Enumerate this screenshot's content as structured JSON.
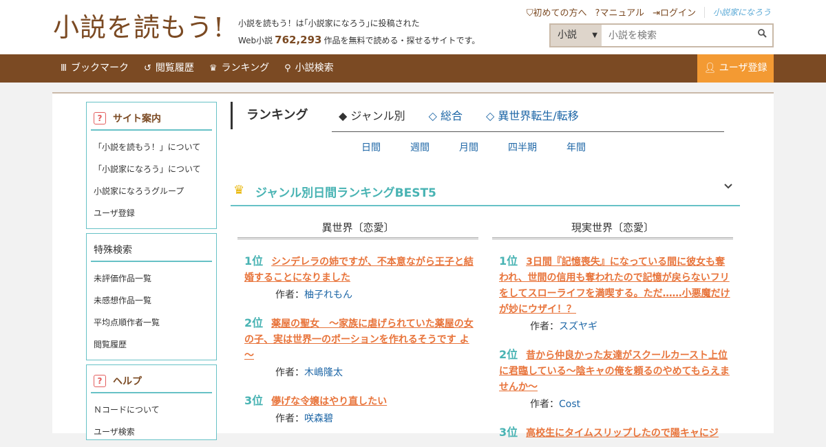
{
  "header": {
    "logo": "小説を読もう!",
    "intro_line1": "小説を読もう！は｢小説家になろう｣に投稿された",
    "intro_prefix": "Web小説",
    "intro_count": "762,293",
    "intro_suffix": "作品を無料で読める・探せるサイトです。",
    "links": [
      "初めての方へ",
      "マニュアル",
      "ログイン"
    ],
    "partner_logo": "小説家になろう",
    "search": {
      "select_value": "小説",
      "placeholder": "小説を検索"
    }
  },
  "nav": {
    "items": [
      {
        "label": "ブックマーク",
        "icon": "bookmark-icon"
      },
      {
        "label": "閲覧履歴",
        "icon": "history-icon"
      },
      {
        "label": "ランキング",
        "icon": "crown-icon"
      },
      {
        "label": "小説検索",
        "icon": "search-icon"
      }
    ],
    "register": "ユーザ登録"
  },
  "sidebar": {
    "site_guide": {
      "title": "サイト案内",
      "items": [
        "「小説を読もう！」について",
        "「小説家になろう」について",
        "小説家になろうグループ",
        "ユーザ登録"
      ]
    },
    "special_search": {
      "title": "特殊検索",
      "items": [
        "未評価作品一覧",
        "未感想作品一覧",
        "平均点順作者一覧",
        "閲覧履歴"
      ]
    },
    "help": {
      "title": "ヘルプ",
      "items": [
        "Ｎコードについて",
        "ユーザ検索"
      ]
    }
  },
  "main": {
    "heading": "ランキング",
    "tabs": [
      "◆ ジャンル別",
      "◇ 総合",
      "◇ 異世界転生/転移"
    ],
    "periods": [
      "日間",
      "週間",
      "月間",
      "四半期",
      "年間"
    ],
    "best_title": "ジャンル別日間ランキングBEST5",
    "author_label": "作者：",
    "columns": [
      {
        "genre": "異世界〔恋愛〕",
        "entries": [
          {
            "rank": "1位",
            "title": "シンデレラの姉ですが、不本意ながら王子と結婚することになりました",
            "author": "柚子れもん"
          },
          {
            "rank": "2位",
            "title": "薬屋の聖女　～家族に虐げられていた薬屋の女の子、実は世界一のポーションを作れるそうです よ～",
            "author": "木嶋隆太"
          },
          {
            "rank": "3位",
            "title": "儚げな令嬢はやり直したい",
            "author": "咲森碧"
          }
        ]
      },
      {
        "genre": "現実世界〔恋愛〕",
        "entries": [
          {
            "rank": "1位",
            "title": "3日間『記憶喪失』になっている間に彼女も奪われ、世間の信用も奪われたので記憶が戻らないフリをしてスローライフを満喫する。ただ……小悪魔だけが妙にウザイ！？",
            "author": "スズヤギ"
          },
          {
            "rank": "2位",
            "title": "昔から仲良かった友達がスクールカースト上位に君臨している～陰キャの俺を頼るのやめてもらえませんか～",
            "author": "Cost"
          },
          {
            "rank": "3位",
            "title": "高校生にタイムスリップしたので陽キャにジ",
            "author": ""
          }
        ]
      }
    ]
  }
}
